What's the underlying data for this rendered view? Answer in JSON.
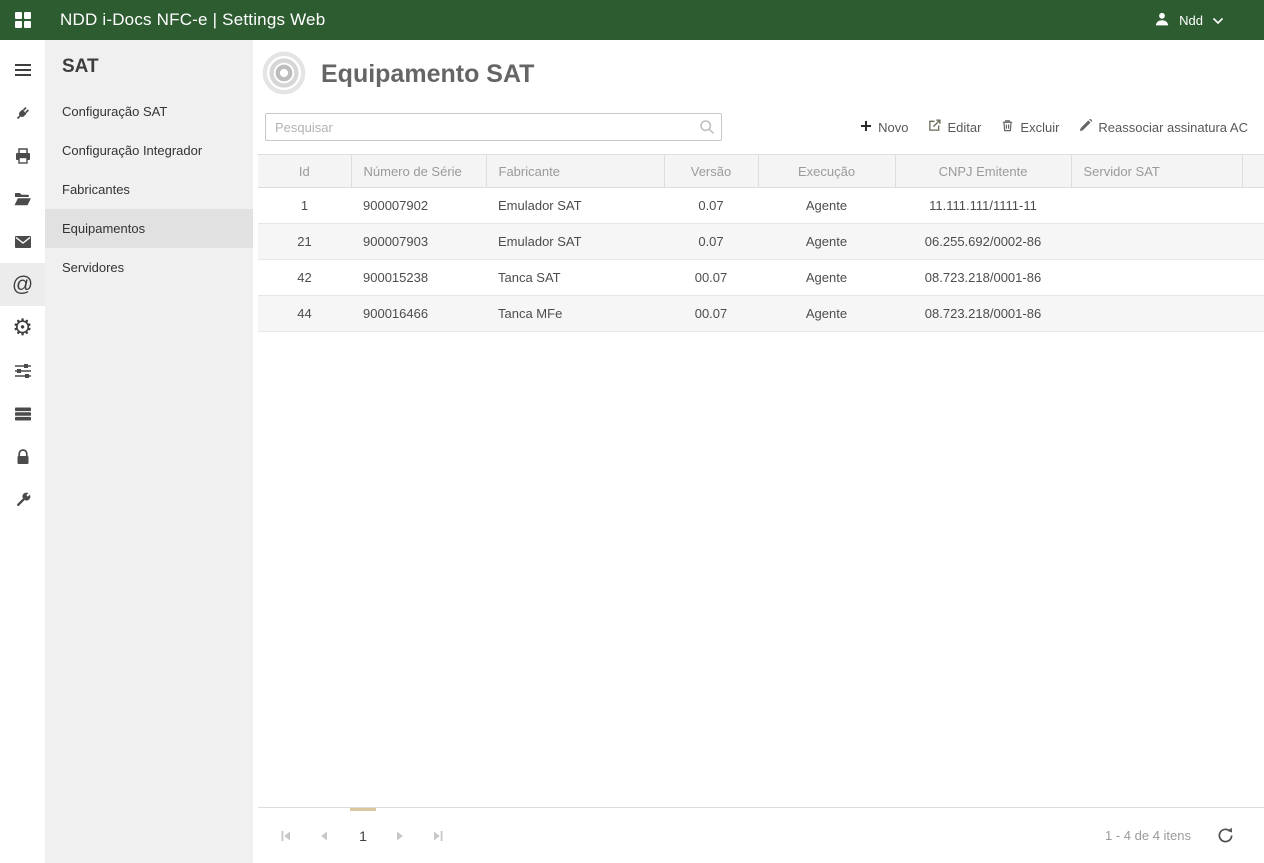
{
  "topbar": {
    "title": "NDD i-Docs NFC-e | Settings Web",
    "user_name": "Ndd"
  },
  "icon_rail": {
    "items": [
      {
        "name": "menu",
        "active": false
      },
      {
        "name": "plug",
        "active": false
      },
      {
        "name": "printer",
        "active": false
      },
      {
        "name": "folder",
        "active": false
      },
      {
        "name": "mail",
        "active": false
      },
      {
        "name": "at-sign",
        "active": true
      },
      {
        "name": "gear",
        "active": false
      },
      {
        "name": "sliders",
        "active": false
      },
      {
        "name": "server",
        "active": false
      },
      {
        "name": "lock",
        "active": false
      },
      {
        "name": "wrench",
        "active": false
      }
    ]
  },
  "sidebar": {
    "heading": "SAT",
    "items": [
      {
        "label": "Configuração SAT",
        "selected": false
      },
      {
        "label": "Configuração Integrador",
        "selected": false
      },
      {
        "label": "Fabricantes",
        "selected": false
      },
      {
        "label": "Equipamentos",
        "selected": true
      },
      {
        "label": "Servidores",
        "selected": false
      }
    ]
  },
  "main": {
    "title": "Equipamento SAT",
    "search": {
      "placeholder": "Pesquisar"
    },
    "toolbar": {
      "novo": "Novo",
      "editar": "Editar",
      "excluir": "Excluir",
      "reassociar": "Reassociar assinatura AC"
    },
    "table": {
      "columns": [
        "Id",
        "Número de Série",
        "Fabricante",
        "Versão",
        "Execução",
        "CNPJ Emitente",
        "Servidor SAT"
      ],
      "rows": [
        [
          "1",
          "900007902",
          "Emulador SAT",
          "0.07",
          "Agente",
          "11.111.111/1111-11",
          ""
        ],
        [
          "21",
          "900007903",
          "Emulador SAT",
          "0.07",
          "Agente",
          "06.255.692/0002-86",
          ""
        ],
        [
          "42",
          "900015238",
          "Tanca SAT",
          "00.07",
          "Agente",
          "08.723.218/0001-86",
          ""
        ],
        [
          "44",
          "900016466",
          "Tanca MFe",
          "00.07",
          "Agente",
          "08.723.218/0001-86",
          ""
        ]
      ]
    },
    "pager": {
      "current_page": "1",
      "info": "1 - 4 de 4 itens"
    }
  },
  "colors": {
    "topbar_green": "#2e5c31",
    "pager_accent": "#d8c7a0",
    "sidebar_bg": "#f0f0f0",
    "selected_item_bg": "#e1e1e1"
  }
}
